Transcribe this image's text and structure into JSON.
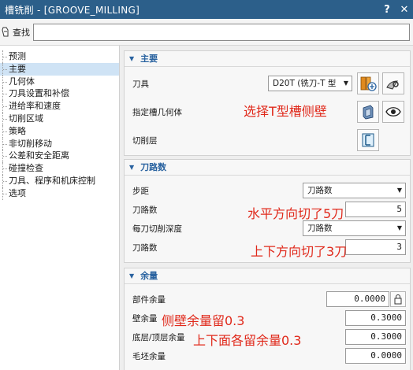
{
  "window": {
    "title": "槽铣削 - [GROOVE_MILLING]",
    "help_btn": "?",
    "close_btn": "✕"
  },
  "search": {
    "label": "查找",
    "value": ""
  },
  "sidebar": {
    "items": [
      {
        "label": "预测"
      },
      {
        "label": "主要"
      },
      {
        "label": "几何体"
      },
      {
        "label": "刀具设置和补偿"
      },
      {
        "label": "进给率和速度"
      },
      {
        "label": "切削区域"
      },
      {
        "label": "策略"
      },
      {
        "label": "非切削移动"
      },
      {
        "label": "公差和安全距离"
      },
      {
        "label": "碰撞检查"
      },
      {
        "label": "刀具、程序和机床控制"
      },
      {
        "label": "选项"
      }
    ]
  },
  "main_group": {
    "header": "主要",
    "tool_label": "刀具",
    "tool_value": "D20T (铣刀-T 型",
    "geometry_label": "指定槽几何体",
    "cut_layers_label": "切削层"
  },
  "toolpath_group": {
    "header": "刀路数",
    "step_label": "步距",
    "step_value": "刀路数",
    "passes_label": "刀路数",
    "passes_value": "5",
    "depth_label": "每刀切削深度",
    "depth_value": "刀路数",
    "passes2_label": "刀路数",
    "passes2_value": "3"
  },
  "stock_group": {
    "header": "余量",
    "part_stock_label": "部件余量",
    "part_stock_value": "0.0000",
    "wall_stock_label": "壁余量",
    "wall_stock_value": "0.3000",
    "floor_stock_label": "底层/顶层余量",
    "floor_stock_value": "0.3000",
    "blank_stock_label": "毛坯余量",
    "blank_stock_value": "0.0000"
  },
  "annotations": {
    "select_wall": "选择T型槽侧壁",
    "horizontal": "水平方向切了5刀",
    "vertical": "上下方向切了3刀",
    "wall_stock": "侧壁余量留0.3",
    "top_bottom": "上下面各留余量0.3"
  },
  "colors": {
    "title_bar": "#2c5f8a",
    "header_text": "#2a63a0",
    "selected_item": "#cfe3f5",
    "annotation": "#e0291b"
  }
}
